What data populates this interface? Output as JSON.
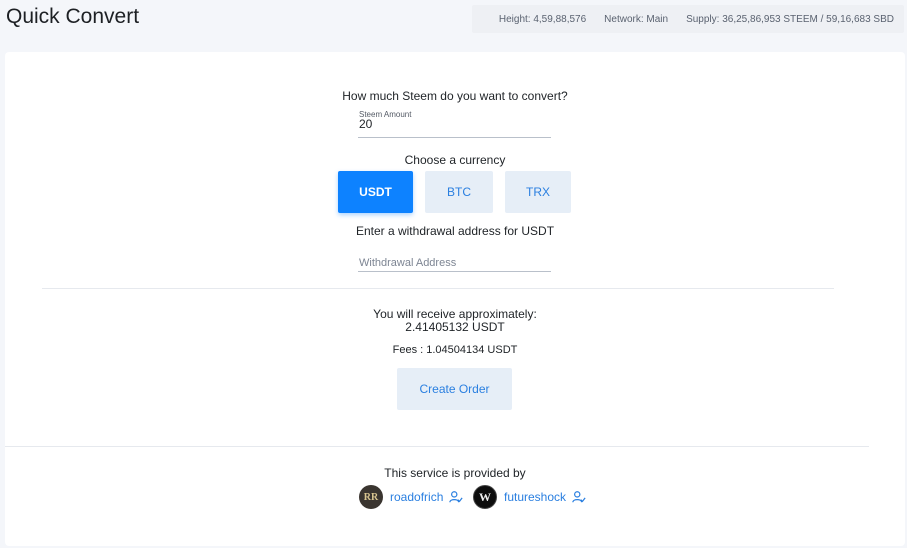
{
  "header": {
    "title": "Quick Convert",
    "stats": {
      "height": "Height: 4,59,88,576",
      "network": "Network: Main",
      "supply": "Supply: 36,25,86,953 STEEM / 59,16,683 SBD"
    }
  },
  "form": {
    "question": "How much Steem do you want to convert?",
    "amount_label": "Steem Amount",
    "amount_value": "20",
    "choose_currency": "Choose a currency",
    "currencies": [
      {
        "label": "USDT",
        "selected": true
      },
      {
        "label": "BTC",
        "selected": false
      },
      {
        "label": "TRX",
        "selected": false
      }
    ],
    "withdraw_label": "Enter a withdrawal address for USDT",
    "withdraw_placeholder": "Withdrawal Address"
  },
  "result": {
    "receive_label": "You will receive approximately:",
    "receive_value": "2.41405132 USDT",
    "fees": "Fees : 1.04504134 USDT",
    "create_button": "Create Order"
  },
  "footer": {
    "provided_by": "This service is provided by",
    "providers": [
      {
        "name": "roadofrich",
        "avatar_text": "RR"
      },
      {
        "name": "futureshock",
        "avatar_text": "W"
      }
    ]
  },
  "colors": {
    "accent": "#0d82ff",
    "button_soft": "#e6eef7",
    "link": "#2a7fe0",
    "background": "#f4f6fa"
  }
}
